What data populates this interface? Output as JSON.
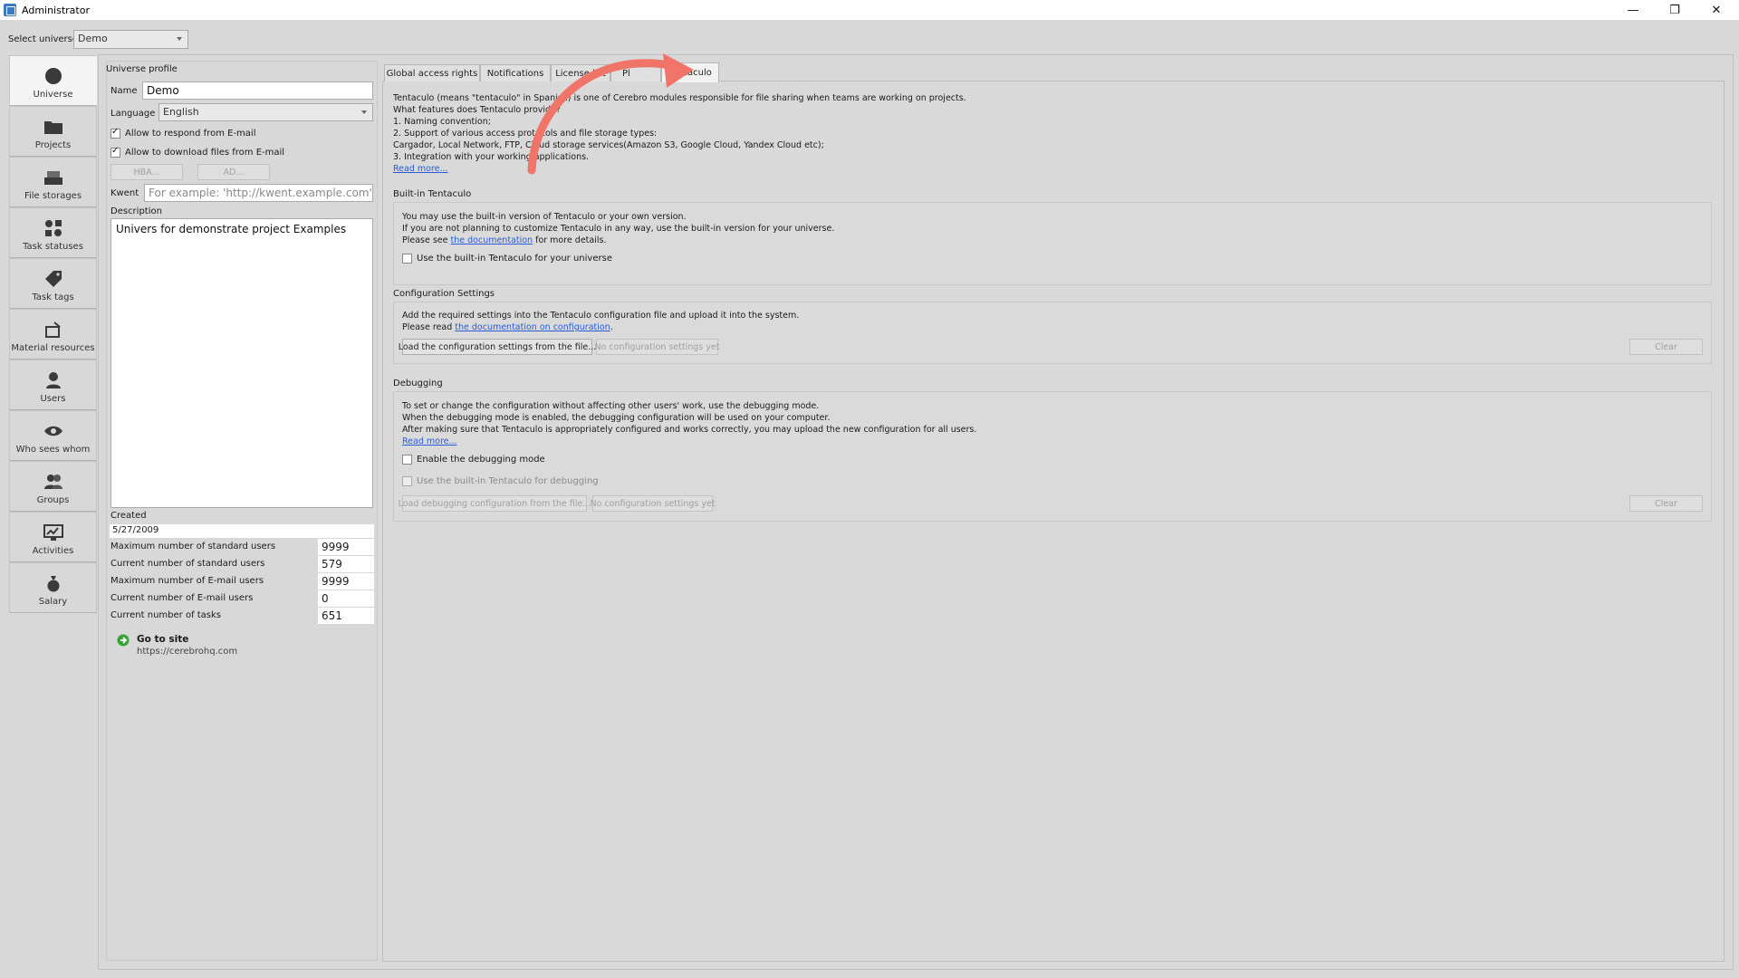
{
  "window": {
    "title": "Administrator",
    "minimize": "—",
    "restore": "❐",
    "close": "✕"
  },
  "universe_select": {
    "label": "Select universe",
    "value": "Demo"
  },
  "sidebar": {
    "items": [
      {
        "label": "Universe",
        "icon": "circle-icon"
      },
      {
        "label": "Projects",
        "icon": "folder-icon"
      },
      {
        "label": "File storages",
        "icon": "storage-icon"
      },
      {
        "label": "Task statuses",
        "icon": "status-icon"
      },
      {
        "label": "Task tags",
        "icon": "tag-icon"
      },
      {
        "label": "Material resources",
        "icon": "box-icon"
      },
      {
        "label": "Users",
        "icon": "user-icon"
      },
      {
        "label": "Who sees whom",
        "icon": "eye-icon"
      },
      {
        "label": "Groups",
        "icon": "group-icon"
      },
      {
        "label": "Activities",
        "icon": "activity-icon"
      },
      {
        "label": "Salary",
        "icon": "money-bag-icon"
      }
    ]
  },
  "profile": {
    "title": "Universe profile",
    "name_label": "Name",
    "name_value": "Demo",
    "language_label": "Language",
    "language_value": "English",
    "allow_respond": "Allow to respond from E-mail",
    "allow_download": "Allow to download files from E-mail",
    "hba_button": "HBA...",
    "ad_button": "AD...",
    "kwent_label": "Kwent",
    "kwent_placeholder": "For example: 'http://kwent.example.com'",
    "description_label": "Description",
    "description_value": "Univers for demonstrate project Examples",
    "created_label": "Created",
    "created_value": "5/27/2009",
    "stats": [
      {
        "label": "Maximum number of standard users",
        "value": "9999"
      },
      {
        "label": "Current number of standard users",
        "value": "579"
      },
      {
        "label": "Maximum number of E-mail users",
        "value": "9999"
      },
      {
        "label": "Current number of E-mail users",
        "value": "0"
      },
      {
        "label": "Current number of tasks",
        "value": "651"
      }
    ],
    "go_to_site": "Go to site",
    "site_url": "https://cerebrohq.com"
  },
  "tabs": [
    "Global access rights",
    "Notifications",
    "License list",
    "Pl",
    "Tentaculo"
  ],
  "tentaculo": {
    "intro": [
      "Tentaculo (means \"tentaculo\" in Spanish) is one of Cerebro modules responsible for file sharing when teams are working on projects.",
      "What features does Tentaculo provide?",
      "1. Naming convention;",
      "2. Support of various access protocols and file storage types:",
      "Cargador, Local Network, FTP, Cloud storage services(Amazon S3, Google Cloud, Yandex Cloud etc);",
      "3. Integration with your working applications."
    ],
    "read_more": "Read more...",
    "builtin": {
      "title": "Built-in Tentaculo",
      "line1": "You may use the built-in version of Tentaculo or your own version.",
      "line2": "If you are not planning to customize Tentaculo in any way, use the built-in version for your universe.",
      "line3_pre": "Please see ",
      "line3_link": "the documentation",
      "line3_post": " for more details.",
      "checkbox": "Use the built-in Tentaculo for your universe"
    },
    "config": {
      "title": "Configuration Settings",
      "line1": "Add the required settings into the Tentaculo configuration file and upload it into the system.",
      "line2_pre": "Please read ",
      "line2_link": "the documentation on configuration",
      "line2_post": ".",
      "load_button": "Load the configuration settings from the file...",
      "status_button": "No configuration settings yet",
      "clear_button": "Clear"
    },
    "debug": {
      "title": "Debugging",
      "line1": "To set or change the configuration without affecting other users' work, use the debugging mode.",
      "line2": "When the debugging mode is enabled, the debugging configuration will be used on your computer.",
      "line3": "After making sure that Tentaculo is appropriately configured and works correctly, you may upload the new configuration for all users.",
      "read_more": "Read more...",
      "enable_checkbox": "Enable the debugging mode",
      "builtin_checkbox": "Use the built-in Tentaculo for debugging",
      "load_button": "Load debugging configuration from the file...",
      "status_button": "No configuration settings yet",
      "clear_button": "Clear"
    }
  },
  "colors": {
    "accent_arrow": "#f07468",
    "link": "#2a5bd7",
    "go_icon": "#3aa23a"
  }
}
